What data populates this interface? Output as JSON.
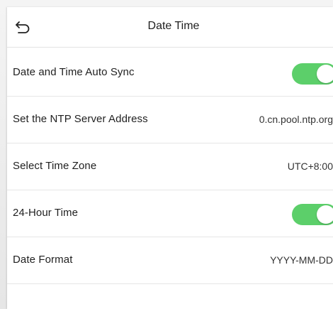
{
  "header": {
    "title": "Date Time",
    "back_icon": "back-arrow-icon"
  },
  "rows": [
    {
      "label": "Date and Time Auto Sync",
      "type": "toggle",
      "on": true
    },
    {
      "label": "Set the NTP Server Address",
      "type": "value",
      "value": "0.cn.pool.ntp.org"
    },
    {
      "label": "Select Time Zone",
      "type": "value",
      "value": "UTC+8:00"
    },
    {
      "label": "24-Hour Time",
      "type": "toggle",
      "on": true
    },
    {
      "label": "Date Format",
      "type": "value",
      "value": "YYYY-MM-DD"
    }
  ],
  "colors": {
    "toggle_on": "#5ccf6a"
  }
}
